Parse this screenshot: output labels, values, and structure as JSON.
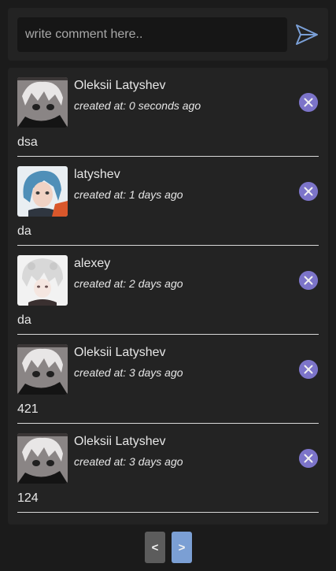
{
  "composer": {
    "placeholder": "write comment here.."
  },
  "icons": {
    "send": "paper-plane-send-icon",
    "delete": "close-circle-icon"
  },
  "colors": {
    "background": "#1b1b1b",
    "panel": "#232323",
    "input": "#161616",
    "delete_button": "#7c74c9",
    "pager_prev": "#5c5c5c",
    "pager_next": "#7b9fd4",
    "send_icon": "#7a9fd6"
  },
  "comments": [
    {
      "author": "Oleksii Latyshev",
      "created": "created at: 0 seconds ago",
      "text": "dsa",
      "avatar": "anime-white-hair-sketch-avatar"
    },
    {
      "author": "latyshev",
      "created": "created at: 1 days ago",
      "text": "da",
      "avatar": "anime-blue-hair-avatar"
    },
    {
      "author": "alexey",
      "created": "created at: 2 days ago",
      "text": "da",
      "avatar": "anime-white-curly-hair-avatar"
    },
    {
      "author": "Oleksii Latyshev",
      "created": "created at: 3 days ago",
      "text": "421",
      "avatar": "anime-white-hair-sketch-avatar"
    },
    {
      "author": "Oleksii Latyshev",
      "created": "created at: 3 days ago",
      "text": "124",
      "avatar": "anime-white-hair-sketch-avatar"
    }
  ],
  "pagination": {
    "prev_label": "<",
    "next_label": ">"
  }
}
